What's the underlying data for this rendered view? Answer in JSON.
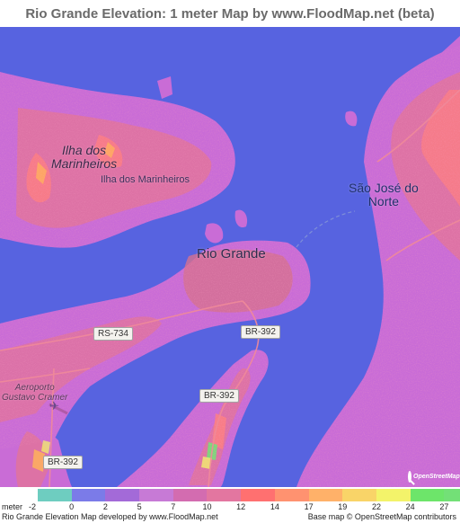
{
  "title": "Rio Grande Elevation: 1 meter Map by www.FloodMap.net (beta)",
  "map": {
    "colors": {
      "water": "#5763e0",
      "land_low": "#c56ad6",
      "land_mid": "#d8719c",
      "land_high": "#ff7f7f",
      "land_peak": "#ffb15a"
    },
    "places": {
      "island_major": "Ilha dos\nMarinheiros",
      "island_minor": "Ilha dos Marinheiros",
      "city": "Rio Grande",
      "town": "São José do\nNorte",
      "airport": "Aeroporto\nGustavo Cramer"
    },
    "roads": {
      "rs734": "RS-734",
      "br392_a": "BR-392",
      "br392_b": "BR-392",
      "br392_c": "BR-392"
    },
    "icons": {
      "airport": "airplane-icon",
      "osm": "openstreetmap-logo"
    },
    "osm_logo_text": "OpenStreetMap"
  },
  "legend": {
    "unit": "meter",
    "labels": [
      "-2",
      "0",
      "2",
      "5",
      "7",
      "10",
      "12",
      "14",
      "17",
      "19",
      "22",
      "24",
      "27"
    ],
    "colors": [
      "#6ecdc0",
      "#7b7be8",
      "#a36ad8",
      "#c77ad6",
      "#d36cb0",
      "#e376a0",
      "#ff7070",
      "#ff9270",
      "#ffb169",
      "#f9d468",
      "#f3f36a",
      "#6de56a",
      "#73e077"
    ]
  },
  "footer": {
    "left": "Rio Grande Elevation Map developed by www.FloodMap.net",
    "right": "Base map © OpenStreetMap contributors"
  }
}
